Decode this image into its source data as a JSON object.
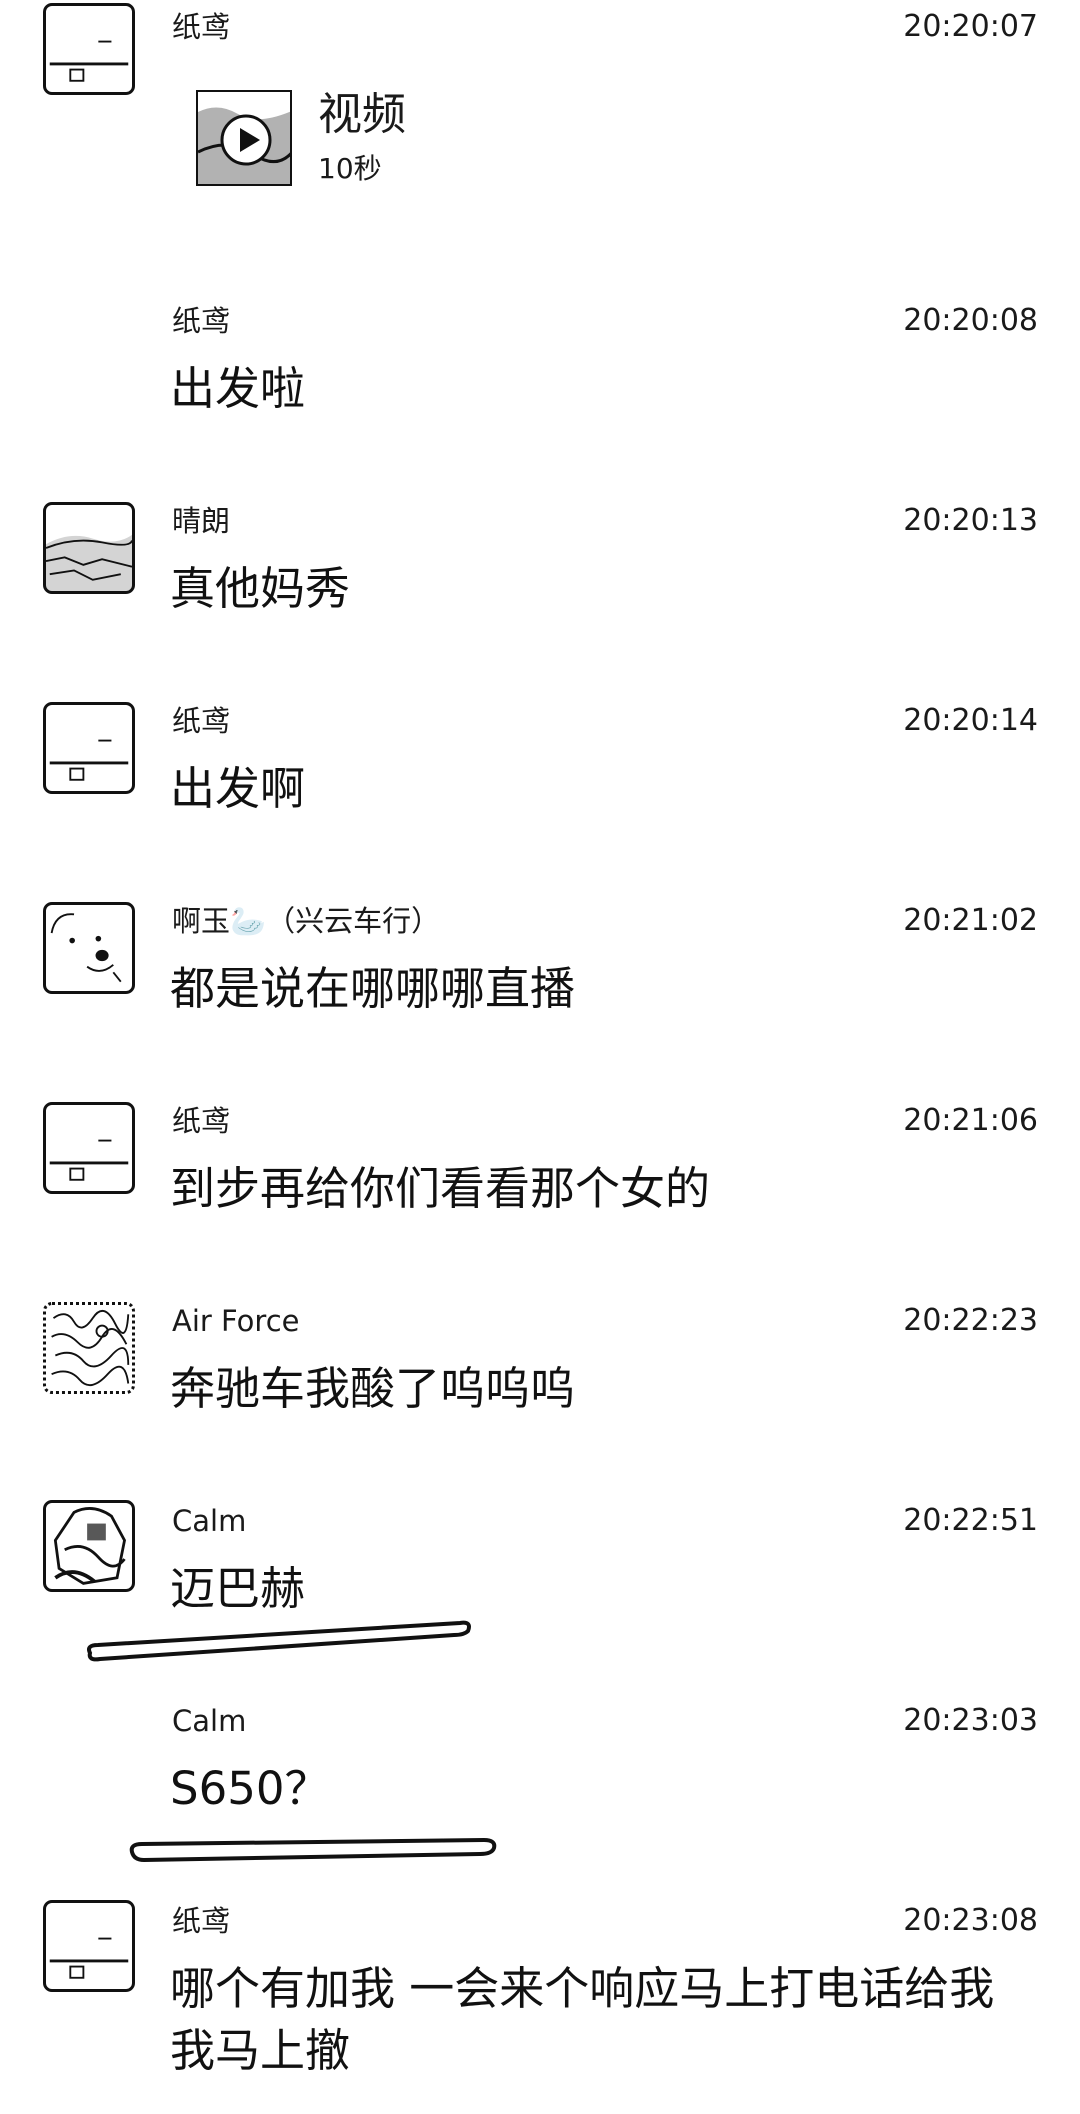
{
  "messages": [
    {
      "sender": "纸鸢",
      "time": "20:20:07",
      "avatar": "kite-avatar-icon",
      "video": {
        "title": "视频",
        "duration": "10秒"
      }
    },
    {
      "sender": "纸鸢",
      "time": "20:20:08",
      "text": "出发啦"
    },
    {
      "sender": "晴朗",
      "time": "20:20:13",
      "text": "真他妈秀",
      "avatar": "landscape-avatar-icon"
    },
    {
      "sender": "纸鸢",
      "time": "20:20:14",
      "text": "出发啊",
      "avatar": "kite-avatar-icon"
    },
    {
      "sender": "啊玉🦢（兴云车行）",
      "time": "20:21:02",
      "text": "都是说在哪哪哪直播",
      "avatar": "dog-avatar-icon"
    },
    {
      "sender": "纸鸢",
      "time": "20:21:06",
      "text": "到步再给你们看看那个女的",
      "avatar": "kite-avatar-icon"
    },
    {
      "sender": "Air Force",
      "time": "20:22:23",
      "text": "奔驰车我酸了呜呜呜",
      "avatar": "sketch-avatar-icon"
    },
    {
      "sender": "Calm",
      "time": "20:22:51",
      "text": "迈巴赫",
      "avatar": "drawing-avatar-icon"
    },
    {
      "sender": "Calm",
      "time": "20:23:03",
      "text": "S650？"
    },
    {
      "sender": "纸鸢",
      "time": "20:23:08",
      "text": "哪个有加我 一会来个响应马上打电话给我我马上撤",
      "avatar": "kite-avatar-icon"
    }
  ]
}
